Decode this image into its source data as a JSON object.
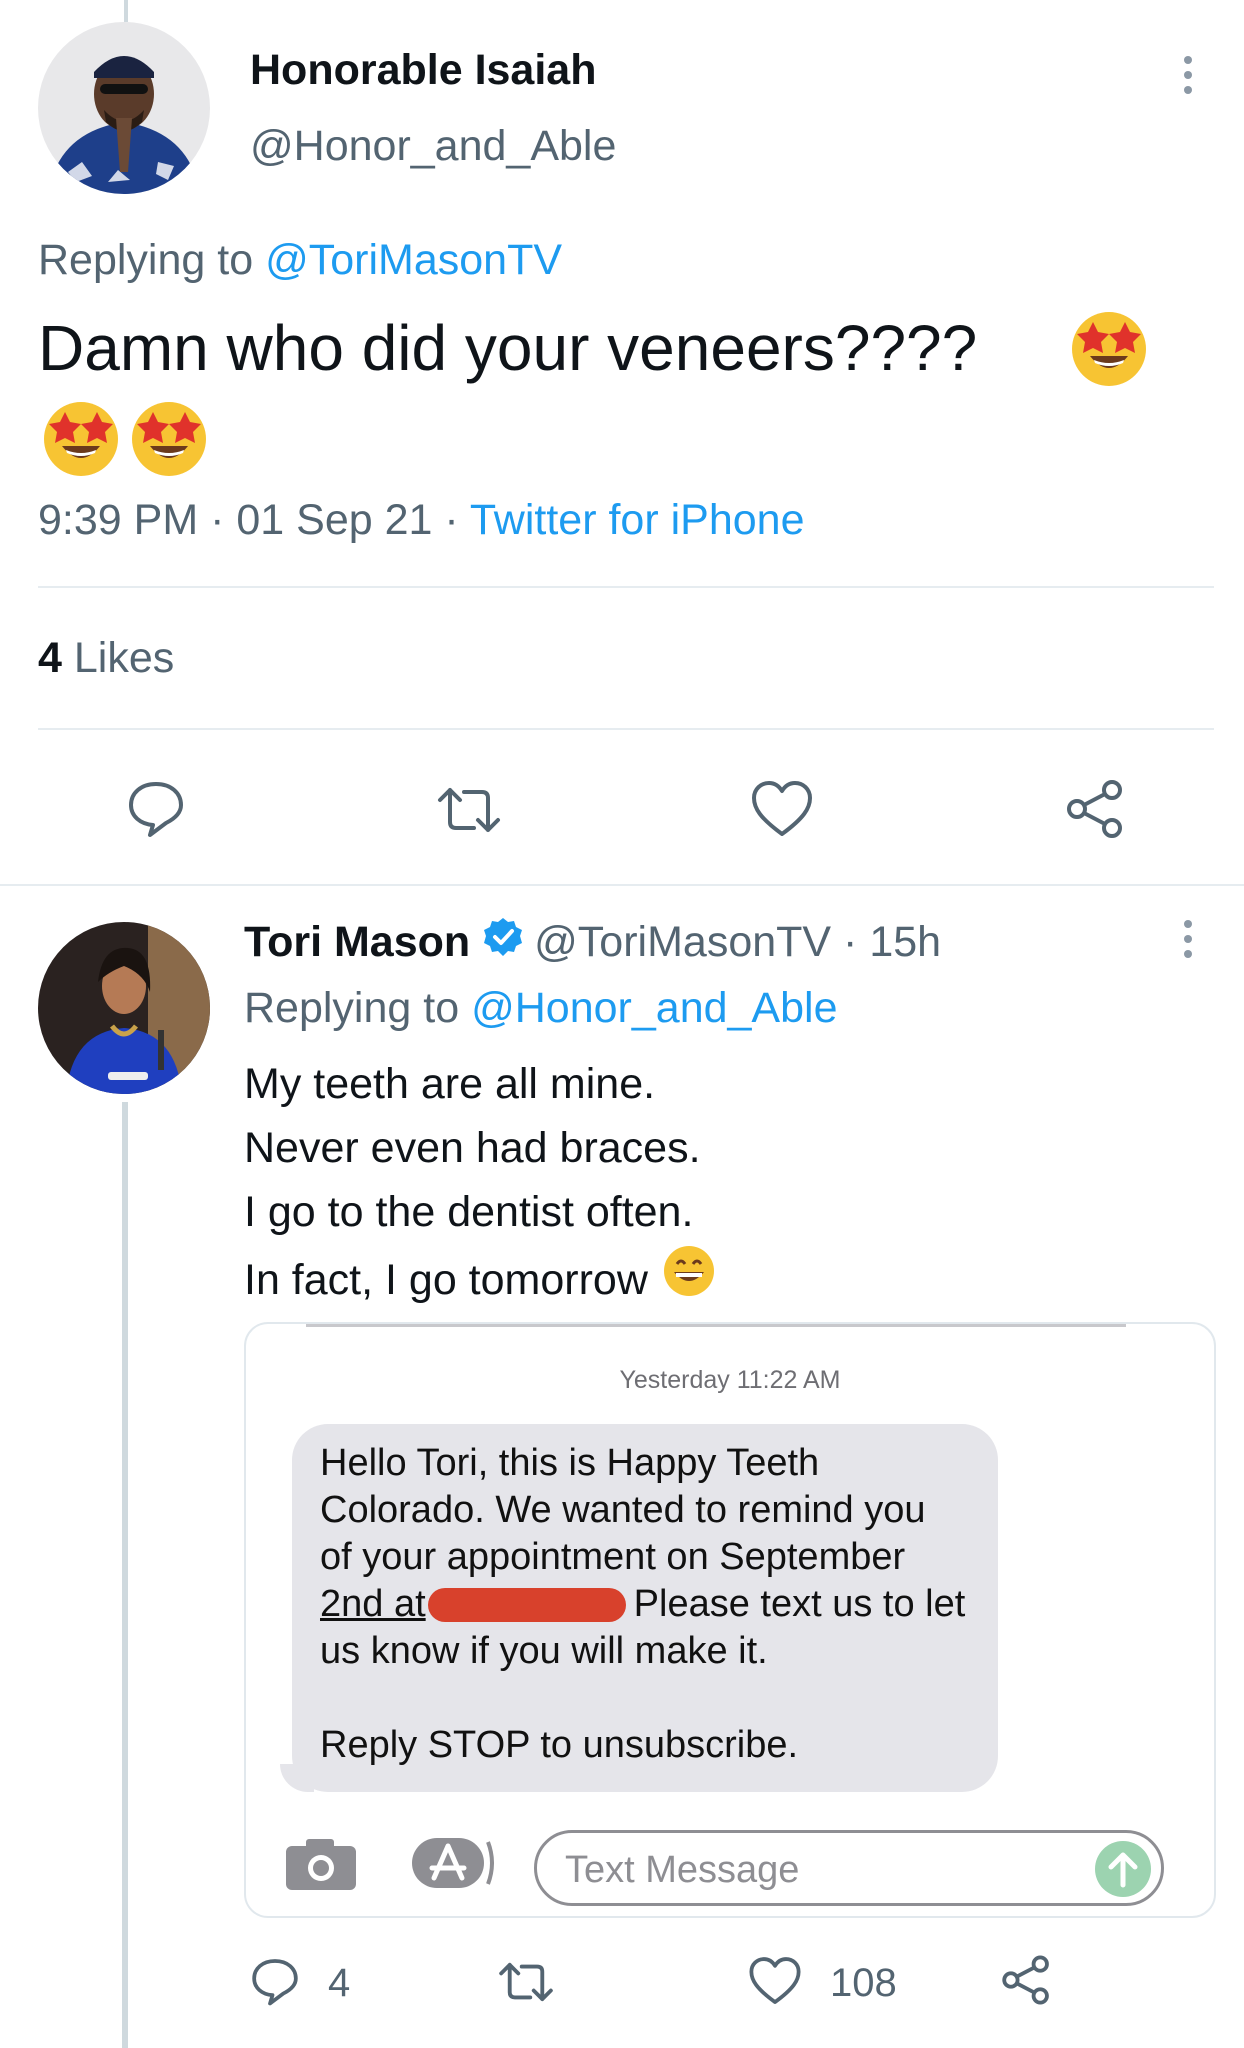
{
  "tweet": {
    "display_name": "Honorable Isaiah",
    "handle": "@Honor_and_Able",
    "replying_prefix": "Replying to",
    "replying_to": "@ToriMasonTV",
    "text": "Damn who did your veneers????",
    "time": "9:39 PM",
    "date": "01 Sep 21",
    "client": "Twitter for iPhone",
    "likes_count": "4",
    "likes_label": "Likes",
    "emoji": "star-struck-face"
  },
  "reply": {
    "display_name": "Tori Mason",
    "handle": "@ToriMasonTV",
    "age": "15h",
    "replying_prefix": "Replying to",
    "replying_to": "@Honor_and_Able",
    "lines": [
      "My teeth are all mine.",
      "Never even had braces.",
      "I go to the dentist often.",
      "In fact, I go tomorrow"
    ],
    "reply_count": "4",
    "like_count": "108",
    "emoji": "grinning-face"
  },
  "screenshot": {
    "timestamp": "Yesterday 11:22 AM",
    "message_lines": [
      "Hello Tori, this is Happy Teeth",
      "Colorado. We wanted to remind you",
      "of your appointment on September",
      "2nd at",
      "Please text us to let",
      "us know if you will make it.",
      "Reply STOP to unsubscribe."
    ],
    "input_placeholder": "Text Message"
  },
  "colors": {
    "link": "#1d9bf0",
    "verified": "#1d9bf0",
    "imessage_bubble": "#e5e5ea",
    "redaction": "#d8412c"
  }
}
